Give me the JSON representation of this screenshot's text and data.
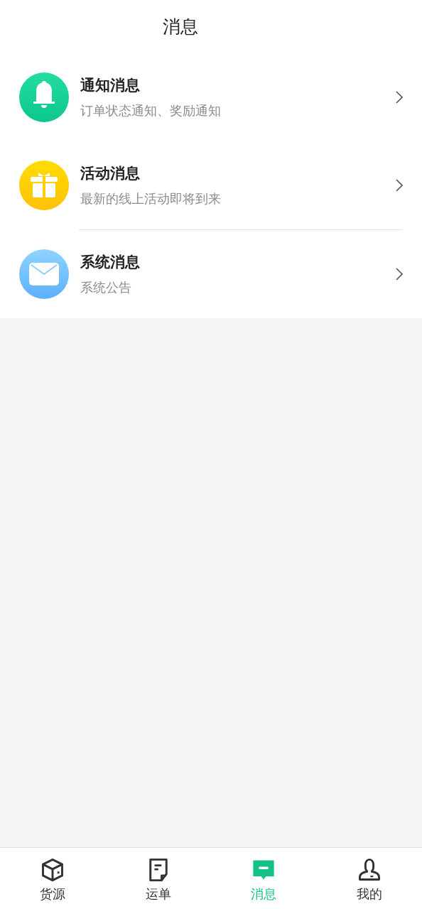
{
  "header": {
    "title": "消息"
  },
  "messages": [
    {
      "kind": "bell",
      "title": "通知消息",
      "subtitle": "订单状态通知、奖励通知",
      "separated": false
    },
    {
      "kind": "gift",
      "title": "活动消息",
      "subtitle": "最新的线上活动即将到来",
      "separated": false
    },
    {
      "kind": "mail",
      "title": "系统消息",
      "subtitle": "系统公告",
      "separated": true
    }
  ],
  "tab_bar": [
    {
      "kind": "box",
      "label": "货源",
      "selected": false
    },
    {
      "kind": "note",
      "label": "运单",
      "selected": false
    },
    {
      "kind": "chat",
      "label": "消息",
      "selected": true
    },
    {
      "kind": "person",
      "label": "我的",
      "selected": false
    }
  ]
}
